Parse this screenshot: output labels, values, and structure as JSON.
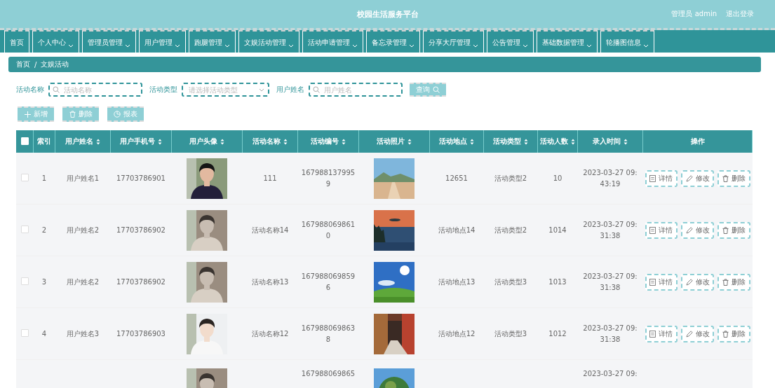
{
  "header": {
    "title": "校园生活服务平台",
    "user": "管理员 admin",
    "logout": "退出登录"
  },
  "nav": [
    {
      "label": "首页",
      "dropdown": false
    },
    {
      "label": "个人中心",
      "dropdown": true
    },
    {
      "label": "管理员管理",
      "dropdown": true
    },
    {
      "label": "用户管理",
      "dropdown": true
    },
    {
      "label": "跑腿管理",
      "dropdown": true
    },
    {
      "label": "文娱活动管理",
      "dropdown": true
    },
    {
      "label": "活动申请管理",
      "dropdown": true
    },
    {
      "label": "备忘录管理",
      "dropdown": true
    },
    {
      "label": "分享大厅管理",
      "dropdown": true
    },
    {
      "label": "公告管理",
      "dropdown": true
    },
    {
      "label": "基础数据管理",
      "dropdown": true
    },
    {
      "label": "轮播图信息",
      "dropdown": true
    }
  ],
  "breadcrumb": {
    "items": [
      "首页",
      "文娱活动"
    ],
    "separator": "/"
  },
  "search": {
    "fields": [
      {
        "label": "活动名称",
        "kind": "text",
        "placeholder": "活动名称"
      },
      {
        "label": "活动类型",
        "kind": "select",
        "placeholder": "请选择活动类型"
      },
      {
        "label": "用户姓名",
        "kind": "text",
        "placeholder": "用户姓名"
      }
    ],
    "button": "查询"
  },
  "actions": [
    {
      "label": "新增",
      "kind": "add"
    },
    {
      "label": "删除",
      "kind": "delete"
    },
    {
      "label": "报表",
      "kind": "report"
    }
  ],
  "table": {
    "select_all": {
      "checked": false
    },
    "columns": [
      {
        "label": "索引",
        "kind": "text",
        "sortable": false
      },
      {
        "label": "用户姓名",
        "kind": "text",
        "sortable": true
      },
      {
        "label": "用户手机号",
        "kind": "text",
        "sortable": true
      },
      {
        "label": "用户头像",
        "kind": "picture",
        "sortable": true
      },
      {
        "label": "活动名称",
        "kind": "text",
        "sortable": true
      },
      {
        "label": "活动编号",
        "kind": "text",
        "sortable": true
      },
      {
        "label": "活动照片",
        "kind": "picture",
        "sortable": true
      },
      {
        "label": "活动地点",
        "kind": "text",
        "sortable": true
      },
      {
        "label": "活动类型",
        "kind": "text",
        "sortable": true
      },
      {
        "label": "活动人数",
        "kind": "text",
        "sortable": true
      },
      {
        "label": "录入时间",
        "kind": "text",
        "sortable": true
      },
      {
        "label": "操作",
        "kind": "actions",
        "sortable": false
      }
    ],
    "rows": [
      {
        "checked": false,
        "index": "1",
        "user": "用户姓名1",
        "phone": "17703786901",
        "name": "111",
        "code": "1679881379959",
        "place": "12651",
        "type": "活动类型2",
        "count": "10",
        "time": "2023-03-27 09:43:19",
        "buttons": [
          {
            "label": "详情",
            "kind": "detail"
          },
          {
            "label": "修改",
            "kind": "edit"
          },
          {
            "label": "删除",
            "kind": "delete"
          }
        ]
      },
      {
        "checked": false,
        "index": "2",
        "user": "用户姓名2",
        "phone": "17703786902",
        "name": "活动名称14",
        "code": "1679880698610",
        "place": "活动地点14",
        "type": "活动类型2",
        "count": "1014",
        "time": "2023-03-27 09:31:38",
        "buttons": [
          {
            "label": "详情",
            "kind": "detail"
          },
          {
            "label": "修改",
            "kind": "edit"
          },
          {
            "label": "删除",
            "kind": "delete"
          }
        ]
      },
      {
        "checked": false,
        "index": "3",
        "user": "用户姓名2",
        "phone": "17703786902",
        "name": "活动名称13",
        "code": "1679880698596",
        "place": "活动地点13",
        "type": "活动类型3",
        "count": "1013",
        "time": "2023-03-27 09:31:38",
        "buttons": [
          {
            "label": "详情",
            "kind": "detail"
          },
          {
            "label": "修改",
            "kind": "edit"
          },
          {
            "label": "删除",
            "kind": "delete"
          }
        ]
      },
      {
        "checked": false,
        "index": "4",
        "user": "用户姓名3",
        "phone": "17703786903",
        "name": "活动名称12",
        "code": "1679880698638",
        "place": "活动地点12",
        "type": "活动类型3",
        "count": "1012",
        "time": "2023-03-27 09:31:38",
        "buttons": [
          {
            "label": "详情",
            "kind": "detail"
          },
          {
            "label": "修改",
            "kind": "edit"
          },
          {
            "label": "删除",
            "kind": "delete"
          }
        ]
      },
      {
        "code": "167988069865",
        "time": "2023-03-27 09:"
      }
    ]
  }
}
